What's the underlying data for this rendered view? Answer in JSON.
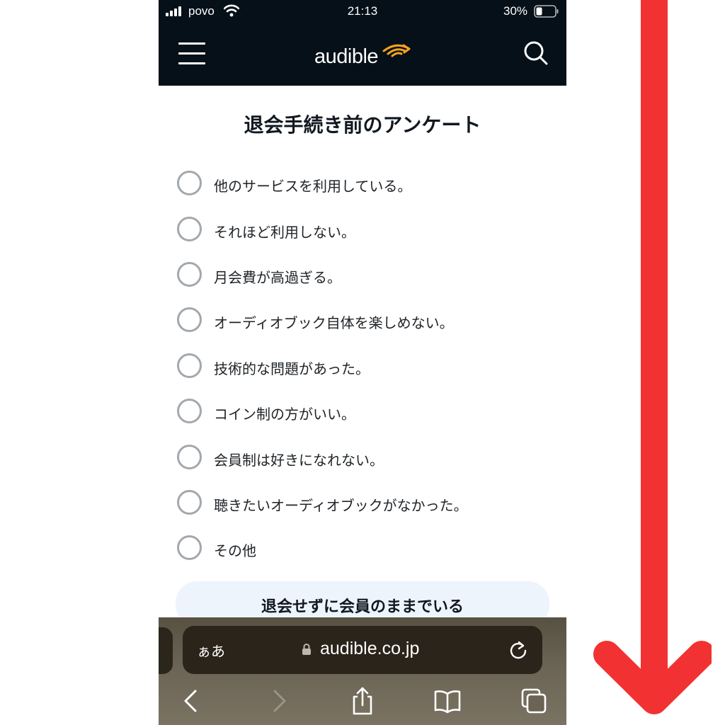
{
  "status_bar": {
    "carrier": "povo",
    "time": "21:13",
    "battery": "30%",
    "icons": [
      "signal-icon",
      "wifi-icon",
      "battery-icon"
    ]
  },
  "header": {
    "logo_text": "audible",
    "icons": [
      "menu-icon",
      "audible-signal-icon",
      "search-icon"
    ]
  },
  "page": {
    "title": "退会手続き前のアンケート",
    "options": [
      "他のサービスを利用している。",
      "それほど利用しない。",
      "月会費が高過ぎる。",
      "オーディオブック自体を楽しめない。",
      "技術的な問題があった。",
      "コイン制の方がいい。",
      "会員制は好きになれない。",
      "聴きたいオーディオブックがなかった。",
      "その他"
    ],
    "stay_button": "退会せずに会員のままでいる"
  },
  "browser": {
    "aa_label": "ぁあ",
    "url": "audible.co.jp",
    "toolbar_icons": [
      "back-icon",
      "forward-icon",
      "share-icon",
      "bookmarks-icon",
      "tabs-icon"
    ]
  },
  "colors": {
    "header_bg": "#051018",
    "logo_accent": "#f7a21b",
    "arrow": "#f23232",
    "stay_button_bg": "#eef4fc",
    "radio_border": "#a3a8ad"
  }
}
